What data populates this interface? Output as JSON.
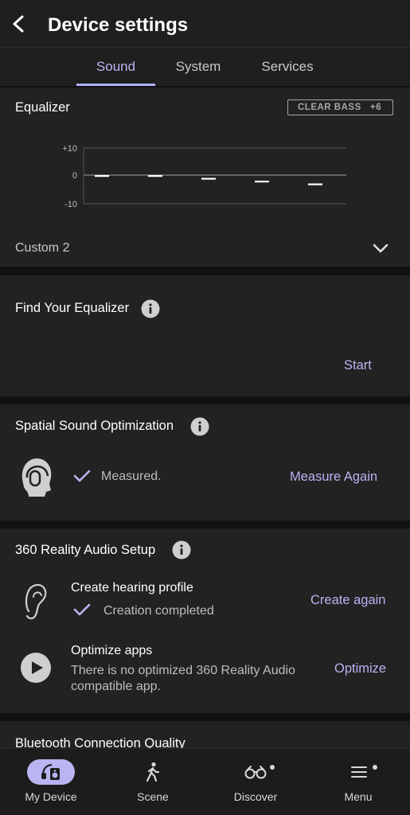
{
  "header": {
    "title": "Device settings"
  },
  "tabs": [
    {
      "label": "Sound"
    },
    {
      "label": "System"
    },
    {
      "label": "Services"
    }
  ],
  "equalizer": {
    "title": "Equalizer",
    "clear_bass_label": "CLEAR BASS",
    "clear_bass_value": "+6",
    "y_ticks": [
      "+10",
      "0",
      "-10"
    ],
    "preset": "Custom 2"
  },
  "chart_data": {
    "type": "line",
    "ylim": [
      -10,
      10
    ],
    "yticks": [
      "+10",
      "0",
      "-10"
    ],
    "values": [
      0,
      0,
      -1,
      -2,
      -3
    ]
  },
  "find_eq": {
    "title": "Find Your Equalizer",
    "start_label": "Start"
  },
  "spatial": {
    "title": "Spatial Sound Optimization",
    "status": "Measured.",
    "measure_again_label": "Measure Again"
  },
  "reality_audio": {
    "title": "360 Reality Audio Setup",
    "hearing_title": "Create hearing profile",
    "hearing_status": "Creation completed",
    "create_again_label": "Create again",
    "optimize_title": "Optimize apps",
    "optimize_desc_line1": "There is no optimized 360 Reality Audio",
    "optimize_desc_line2": "compatible app.",
    "optimize_label": "Optimize"
  },
  "bluetooth": {
    "title": "Bluetooth Connection Quality"
  },
  "bottom_nav": [
    {
      "label": "My Device"
    },
    {
      "label": "Scene"
    },
    {
      "label": "Discover"
    },
    {
      "label": "Menu"
    }
  ],
  "colors": {
    "accent": "#b9b4f2",
    "background": "#111111",
    "card": "#222222"
  }
}
